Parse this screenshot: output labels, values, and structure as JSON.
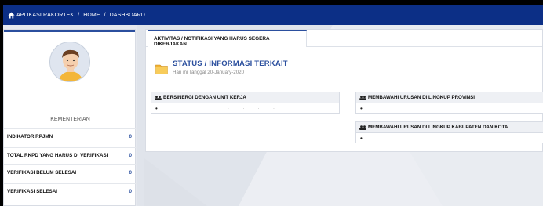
{
  "navbar": {
    "app_name": "APLIKASI RAKORTEK",
    "breadcrumb": [
      "HOME",
      "DASHBOARD"
    ],
    "separator": "/"
  },
  "sidebar": {
    "org_label": "KEMENTERIAN",
    "items": [
      {
        "label": "INDIKATOR RPJMN",
        "count": "0"
      },
      {
        "label": "TOTAL RKPD YANG HARUS DI VERIFIKASI",
        "count": "0"
      },
      {
        "label": "VERIFIKASI BELUM SELESAI",
        "count": "0"
      },
      {
        "label": "VERIFIKASI SELESAI",
        "count": "0"
      }
    ]
  },
  "main": {
    "tab_label": "AKTIVITAS / NOTIFIKASI YANG HARUS SEGERA DIKERJAKAN",
    "status_title": "STATUS / INFORMASI TERKAIT",
    "status_date": "Hari ini Tanggal 20-January-2020",
    "panels": [
      {
        "title": "BERSINERGI DENGAN UNIT KERJA",
        "bullet": "•",
        "faint": ". . . . ."
      },
      {
        "title": "MEMBAWAHI URUSAN DI LINGKUP PROVINSI",
        "bullet": "•"
      },
      {
        "title": "MEMBAWAHI URUSAN DI LINGKUP KABUPATEN DAN KOTA",
        "bullet": "•"
      }
    ]
  },
  "colors": {
    "navbar": "#0c2f86",
    "accent": "#2b4f9e",
    "background": "#e6e9ef"
  },
  "icons": {
    "home": "home-icon",
    "avatar": "user-avatar",
    "folder": "folder-icon",
    "group": "group-icon"
  }
}
